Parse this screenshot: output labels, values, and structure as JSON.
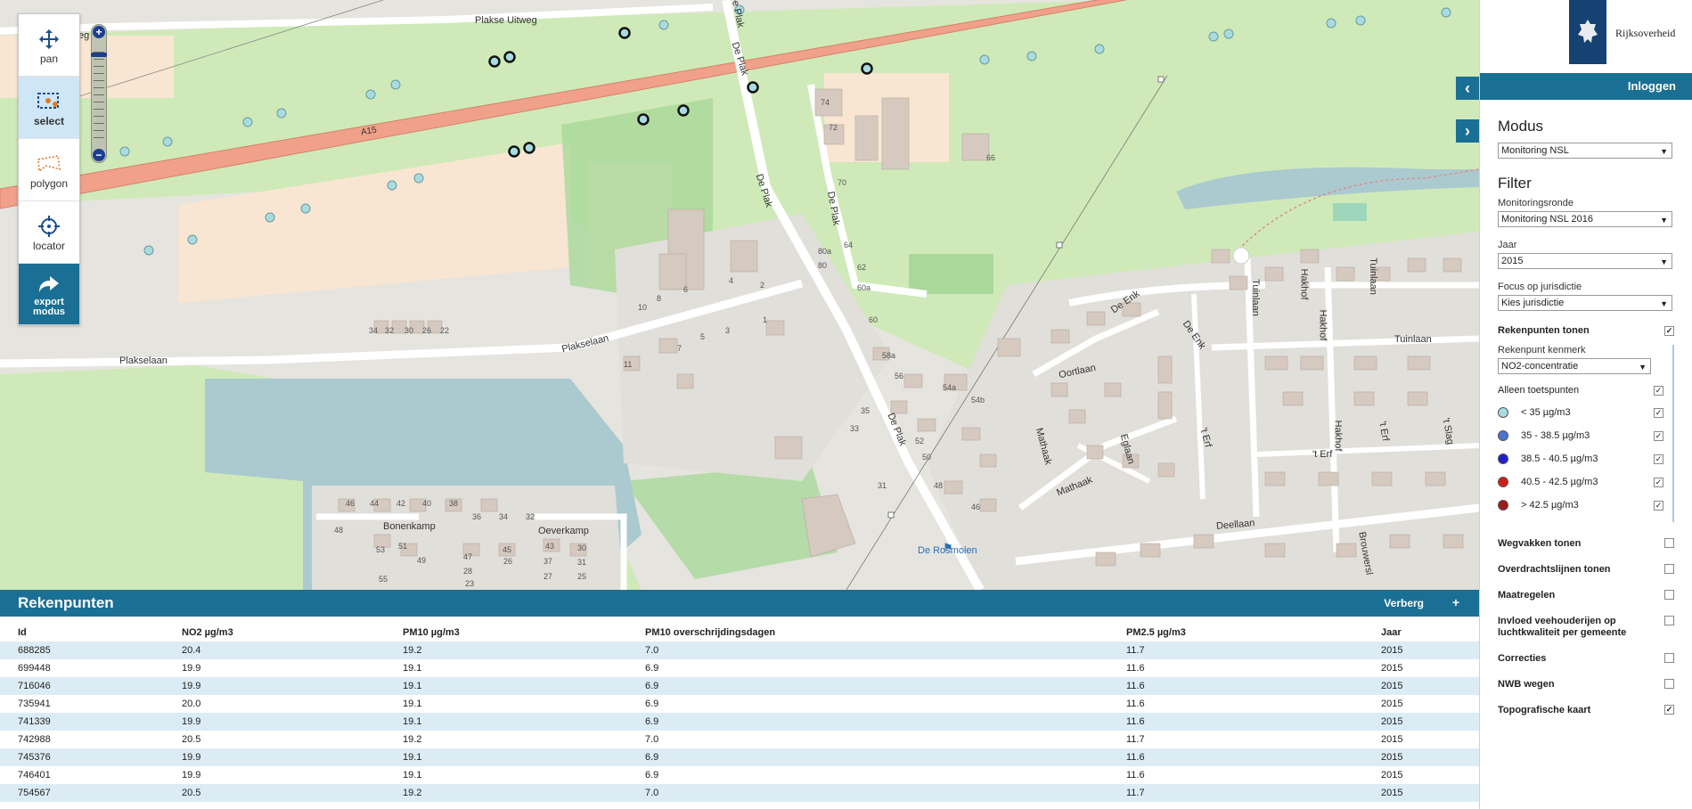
{
  "map": {
    "roads": {
      "plakse_uitweg": "Plakse Uitweg",
      "plakse_uitweg_cut": "eg",
      "plakselaan": "Plakselaan",
      "de_plak": "De Plak",
      "a15": "A15",
      "bonenkamp": "Bonenkamp",
      "oeverkamp": "Oeverkamp",
      "oortlaan": "Oortlaan",
      "mathaak": "Mathaak",
      "eglaan": "Eglaan",
      "deellaan": "Deellaan",
      "tuinlaan": "Tuinlaan",
      "hakhof": "Hakhof",
      "t_erf": "'t Erf",
      "de_enk": "De Enk",
      "brouwerslaan": "Brouwersl",
      "t_slag": "'t Slag"
    },
    "poi": {
      "de_rosmolen": "De Rosmolen"
    },
    "numbers": [
      "74",
      "72",
      "70",
      "66",
      "80a",
      "64",
      "62",
      "60a",
      "80",
      "60",
      "58a",
      "56",
      "54a",
      "54b",
      "52",
      "50",
      "48",
      "46",
      "35",
      "33",
      "31",
      "10",
      "8",
      "6",
      "4",
      "2",
      "1",
      "3",
      "5",
      "7",
      "34",
      "32",
      "30",
      "26",
      "22",
      "11",
      "46",
      "44",
      "42",
      "40",
      "38",
      "36",
      "34",
      "32",
      "48",
      "53",
      "51",
      "49",
      "47",
      "45",
      "43",
      "30",
      "28",
      "26",
      "37",
      "31",
      "27",
      "25",
      "23",
      "55"
    ]
  },
  "toolbox": {
    "pan": "pan",
    "select": "select",
    "polygon": "polygon",
    "locator": "locator",
    "export": "export modus"
  },
  "zoom": {
    "plus": "+",
    "minus": "−"
  },
  "table": {
    "title": "Rekenpunten",
    "hide_label": "Verberg",
    "plus_label": "+",
    "columns": [
      "Id",
      "NO2 µg/m3",
      "PM10 µg/m3",
      "PM10 overschrijdingsdagen",
      "PM2.5 µg/m3",
      "Jaar"
    ],
    "rows": [
      [
        "688285",
        "20.4",
        "19.2",
        "7.0",
        "11.7",
        "2015"
      ],
      [
        "699448",
        "19.9",
        "19.1",
        "6.9",
        "11.6",
        "2015"
      ],
      [
        "716046",
        "19.9",
        "19.1",
        "6.9",
        "11.6",
        "2015"
      ],
      [
        "735941",
        "20.0",
        "19.1",
        "6.9",
        "11.6",
        "2015"
      ],
      [
        "741339",
        "19.9",
        "19.1",
        "6.9",
        "11.6",
        "2015"
      ],
      [
        "742988",
        "20.5",
        "19.2",
        "7.0",
        "11.7",
        "2015"
      ],
      [
        "745376",
        "19.9",
        "19.1",
        "6.9",
        "11.6",
        "2015"
      ],
      [
        "746401",
        "19.9",
        "19.1",
        "6.9",
        "11.6",
        "2015"
      ],
      [
        "754567",
        "20.5",
        "19.2",
        "7.0",
        "11.7",
        "2015"
      ]
    ]
  },
  "sidebar": {
    "logo_text": "Rijksoverheid",
    "login": "Inloggen",
    "modus_title": "Modus",
    "modus_value": "Monitoring NSL",
    "filter_title": "Filter",
    "monitoringsronde_label": "Monitoringsronde",
    "monitoringsronde_value": "Monitoring NSL 2016",
    "jaar_label": "Jaar",
    "jaar_value": "2015",
    "focus_label": "Focus op jurisdictie",
    "focus_value": "Kies jurisdictie",
    "rekenpunten_tonen": "Rekenpunten tonen",
    "kenmerk_label": "Rekenpunt kenmerk",
    "kenmerk_value": "NO2-concentratie",
    "alleen_toetspunten": "Alleen toetspunten",
    "legend": [
      {
        "label": "< 35 µg/m3",
        "color": "#a8dce0"
      },
      {
        "label": "35 - 38.5 µg/m3",
        "color": "#4a74d0"
      },
      {
        "label": "38.5 - 40.5 µg/m3",
        "color": "#1d20c8"
      },
      {
        "label": "40.5 - 42.5 µg/m3",
        "color": "#d41c1c"
      },
      {
        "label": "> 42.5 µg/m3",
        "color": "#a01818"
      }
    ],
    "options": [
      "Wegvakken tonen",
      "Overdrachtslijnen tonen",
      "Maatregelen",
      "Invloed veehouderijen op luchtkwaliteit per gemeente",
      "Correcties",
      "NWB wegen",
      "Topografische kaart"
    ],
    "collapse_icon": "chevron-left-icon",
    "expand_icon": "chevron-right-icon"
  },
  "colors": {
    "brand_blue": "#1a6f94",
    "row_alt": "#dcecf4",
    "motorway": "#f0a08a",
    "grass": "#c9e7b0"
  }
}
